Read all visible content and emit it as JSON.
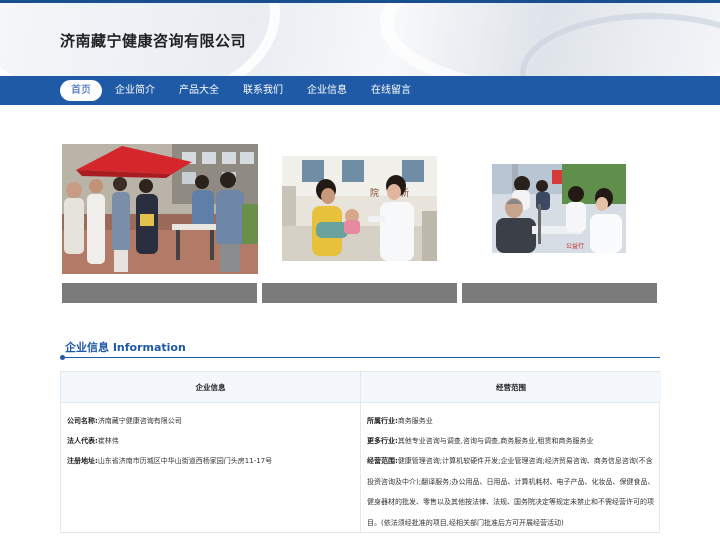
{
  "site": {
    "company_name": "济南藏宁健康咨询有限公司"
  },
  "nav": {
    "items": [
      {
        "label": "首页",
        "active": true
      },
      {
        "label": "企业简介"
      },
      {
        "label": "产品大全"
      },
      {
        "label": "联系我们"
      },
      {
        "label": "企业信息"
      },
      {
        "label": "在线留言"
      }
    ]
  },
  "section": {
    "title": "企业信息 Information"
  },
  "table": {
    "left_header": "企业信息",
    "right_header": "经营范围",
    "left_rows": [
      {
        "label": "公司名称:",
        "value": "济南藏宁健康咨询有限公司"
      },
      {
        "label": "法人代表:",
        "value": "崔林伟"
      },
      {
        "label": "注册地址:",
        "value": "山东省济南市历城区中华山街道西杨家园门头房11-17号"
      }
    ],
    "right_rows": [
      {
        "label": "所属行业:",
        "value": "商务服务业"
      },
      {
        "label": "更多行业:",
        "value": "其他专业咨询与调查,咨询与调查,商务服务业,租赁和商务服务业"
      },
      {
        "label": "经营范围:",
        "value": "健康管理咨询;计算机软硬件开发;企业管理咨询;经济贸易咨询、商务信息咨询(不含投资咨询及中介);翻译服务;办公用品、日用品、计算机耗材、电子产品、化妆品、保健食品、健身器材的批发、零售以及其他按法律、法规、国务院决定等规定未禁止和不需经营许可的项目。(依法须经批准的项目,经相关部门批准后方可开展经营活动)"
      }
    ]
  },
  "colors": {
    "brand": "#1f5aa6",
    "caption_bar": "#7b7b7b"
  }
}
